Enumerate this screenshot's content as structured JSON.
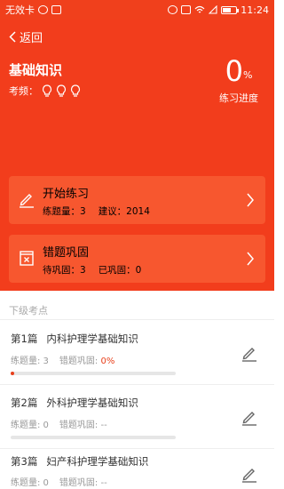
{
  "status": {
    "carrier": "无效卡",
    "time": "11:24",
    "icons_left": [
      "chat-icon",
      "image-icon"
    ],
    "icons_right": [
      "alarm-icon",
      "vibrate-icon",
      "wifi-icon",
      "signal-icon",
      "battery-icon"
    ],
    "battery_level": 0.7
  },
  "header": {
    "back": "返回",
    "title": "基础知识",
    "freq_label": "考频：",
    "bulbs": 3,
    "progress_value": "0",
    "progress_unit": "%",
    "progress_label": "练习进度"
  },
  "cards": [
    {
      "title": "开始练习",
      "sub1": "练题量：3",
      "sub2": "建议：2014",
      "icon": "pencil-icon"
    },
    {
      "title": "错题巩固",
      "sub1": "待巩固：3",
      "sub2": "已巩固：0",
      "icon": "error-book-icon"
    }
  ],
  "section_label": "下级考点",
  "items": [
    {
      "chapter": "第1篇",
      "name": "内科护理学基础知识",
      "count_label": "练题量: 3",
      "consolidate_label": "错题巩固:",
      "consolidate_value": "0%",
      "progress": 0.02
    },
    {
      "chapter": "第2篇",
      "name": "外科护理学基础知识",
      "count_label": "练题量: 0",
      "consolidate_label": "错题巩固:",
      "consolidate_value": "--",
      "progress": 0
    },
    {
      "chapter": "第3篇",
      "name": "妇产科护理学基础知识",
      "count_label": "练题量: 0",
      "consolidate_label": "错题巩固:",
      "consolidate_value": "--",
      "progress": 0
    }
  ],
  "colors": {
    "accent": "#f23d1c",
    "card": "#f7572f"
  }
}
